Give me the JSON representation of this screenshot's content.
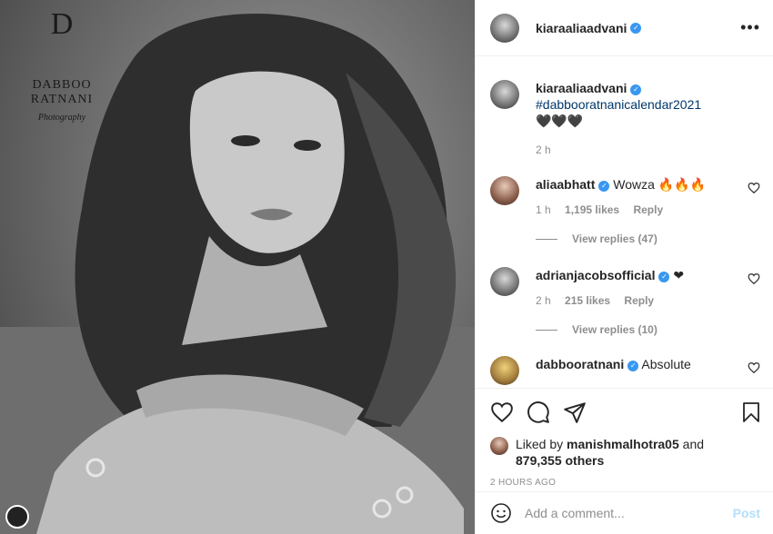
{
  "brand": {
    "mark": "D",
    "name": "DABBOO RATNANI",
    "subtitle": "Photography"
  },
  "post": {
    "username": "kiaraaliaadvani",
    "caption_hashtag": "#dabbooratnanicalendar2021",
    "caption_emoji": "🖤🖤🖤",
    "caption_time": "2 h"
  },
  "comments": [
    {
      "username": "aliaabhatt",
      "text": "Wowza 🔥🔥🔥",
      "time": "1 h",
      "likes": "1,195 likes",
      "reply": "Reply",
      "replies": "View replies (47)"
    },
    {
      "username": "adrianjacobsofficial",
      "text": "❤",
      "time": "2 h",
      "likes": "215 likes",
      "reply": "Reply",
      "replies": "View replies (10)"
    },
    {
      "username": "dabbooratnani",
      "text": "Absolute"
    }
  ],
  "likes": {
    "prefix": "Liked by",
    "user": "manishmalhotra05",
    "and": "and",
    "count": "879,355 others"
  },
  "time_ago": "2 HOURS AGO",
  "add_comment": {
    "placeholder": "Add a comment...",
    "post_label": "Post"
  },
  "icons": {
    "more": "more-options-icon",
    "like": "heart-icon",
    "comment": "comment-icon",
    "share": "share-icon",
    "save": "bookmark-icon",
    "emoji": "emoji-icon",
    "verified": "verified-badge-icon"
  },
  "colors": {
    "link": "#00376b",
    "verified": "#3897f0",
    "muted": "#8e8e8e",
    "post_disabled": "#b2dffc"
  }
}
